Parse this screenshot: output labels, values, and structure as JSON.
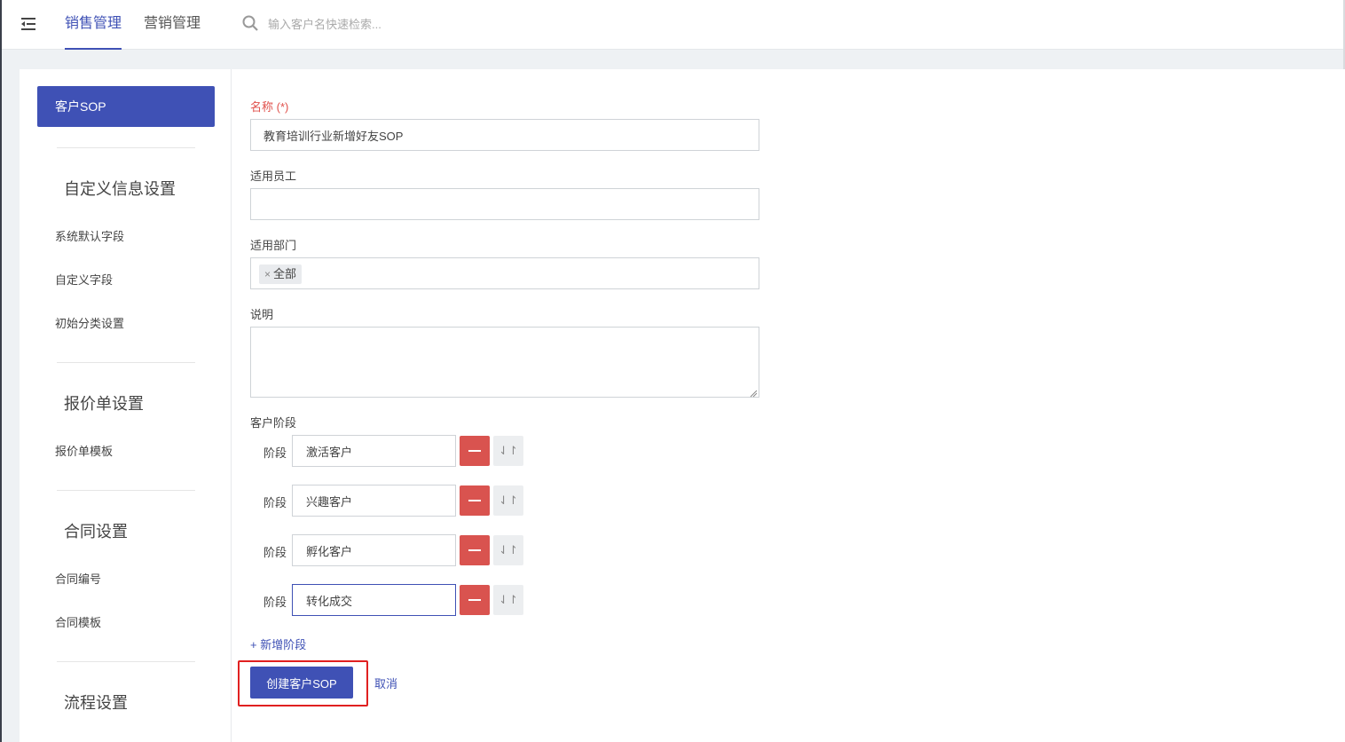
{
  "topbar": {
    "tabs": [
      {
        "label": "销售管理",
        "active": true
      },
      {
        "label": "营销管理",
        "active": false
      }
    ],
    "search_placeholder": "输入客户名快速检索..."
  },
  "sidebar": {
    "active_item": "客户SOP",
    "sections": [
      {
        "heading": "自定义信息设置",
        "items": [
          "系统默认字段",
          "自定义字段",
          "初始分类设置"
        ]
      },
      {
        "heading": "报价单设置",
        "items": [
          "报价单模板"
        ]
      },
      {
        "heading": "合同设置",
        "items": [
          "合同编号",
          "合同模板"
        ]
      },
      {
        "heading": "流程设置",
        "items": []
      }
    ]
  },
  "form": {
    "name_label": "名称 (*)",
    "name_value": "教育培训行业新增好友SOP",
    "staff_label": "适用员工",
    "staff_value": "",
    "dept_label": "适用部门",
    "dept_tag": "全部",
    "desc_label": "说明",
    "desc_value": "",
    "stages_label": "客户阶段",
    "stage_prefix": "阶段",
    "stages": [
      "激活客户",
      "兴趣客户",
      "孵化客户",
      "转化成交"
    ],
    "add_stage_label": "+ 新增阶段",
    "create_button": "创建客户SOP",
    "cancel_label": "取消"
  },
  "colors": {
    "primary": "#3f51b5",
    "danger": "#d9534f",
    "required": "#e0514c",
    "highlight": "#e02020"
  }
}
